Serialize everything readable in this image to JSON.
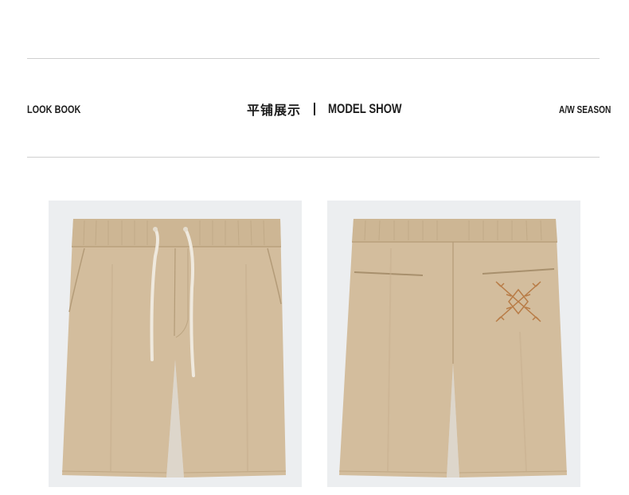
{
  "header": {
    "left_label": "LOOK BOOK",
    "center_cn": "平铺展示",
    "center_en": "MODEL SHOW",
    "right_label": "A/W SEASON"
  },
  "colors": {
    "fabric": "#d3bd9d",
    "fabric_shadow": "#c2aa87",
    "waistband": "#cdb694",
    "drawstring": "#efe9de",
    "panel_bg": "#eceef0",
    "embroidery": "#b6763e",
    "rule": "#cfcfcf"
  },
  "images": [
    {
      "name": "shorts-front",
      "view": "front"
    },
    {
      "name": "shorts-back",
      "view": "back"
    }
  ]
}
